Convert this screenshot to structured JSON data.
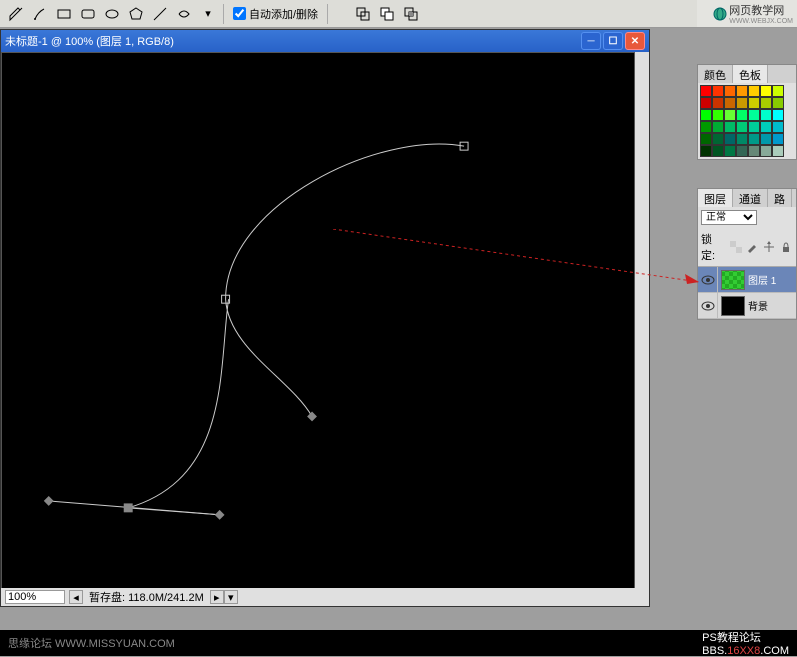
{
  "toolbar": {
    "auto_add_remove_label": "自动添加/删除"
  },
  "document": {
    "title": "未标题-1 @ 100% (图层 1, RGB/8)",
    "zoom_pct": "100%",
    "status_text": "暂存盘: 118.0M/241.2M"
  },
  "logo": {
    "text": "网页教学网",
    "sub": "WWW.WEBJX.COM"
  },
  "swatch_panel": {
    "tab_color": "颜色",
    "tab_swatches": "色板",
    "colors": [
      "#ff0000",
      "#ff3300",
      "#ff6600",
      "#ff9900",
      "#ffcc00",
      "#ffff00",
      "#ccff00",
      "#cc0000",
      "#cc3300",
      "#cc6600",
      "#cc9900",
      "#cccc00",
      "#aacc00",
      "#88cc00",
      "#00ff00",
      "#33ff00",
      "#66ff33",
      "#00ff66",
      "#00ff99",
      "#00ffcc",
      "#00ffff",
      "#009900",
      "#00aa33",
      "#00bb66",
      "#00cc77",
      "#00cc99",
      "#00ccbb",
      "#00bbcc",
      "#006600",
      "#006633",
      "#006666",
      "#008866",
      "#009988",
      "#0099aa",
      "#0099cc",
      "#003300",
      "#005522",
      "#007744",
      "#336655",
      "#668877",
      "#88aa99",
      "#aaccbb"
    ]
  },
  "layer_panel": {
    "tab_layers": "图层",
    "tab_channels": "通道",
    "tab_paths": "路",
    "blend_mode": "正常",
    "lock_label": "锁定:",
    "layers": [
      {
        "name": "图层 1",
        "thumb_color": "#33cc33",
        "pattern": true
      },
      {
        "name": "背景",
        "thumb_color": "#000000",
        "pattern": false
      }
    ]
  },
  "footer": {
    "left": "思缘论坛  WWW.MISSYUAN.COM",
    "right_label": "PS教程论坛",
    "right_url_prefix": "BBS.",
    "right_url_mid": "16XX8",
    "right_url_suffix": ".COM"
  }
}
